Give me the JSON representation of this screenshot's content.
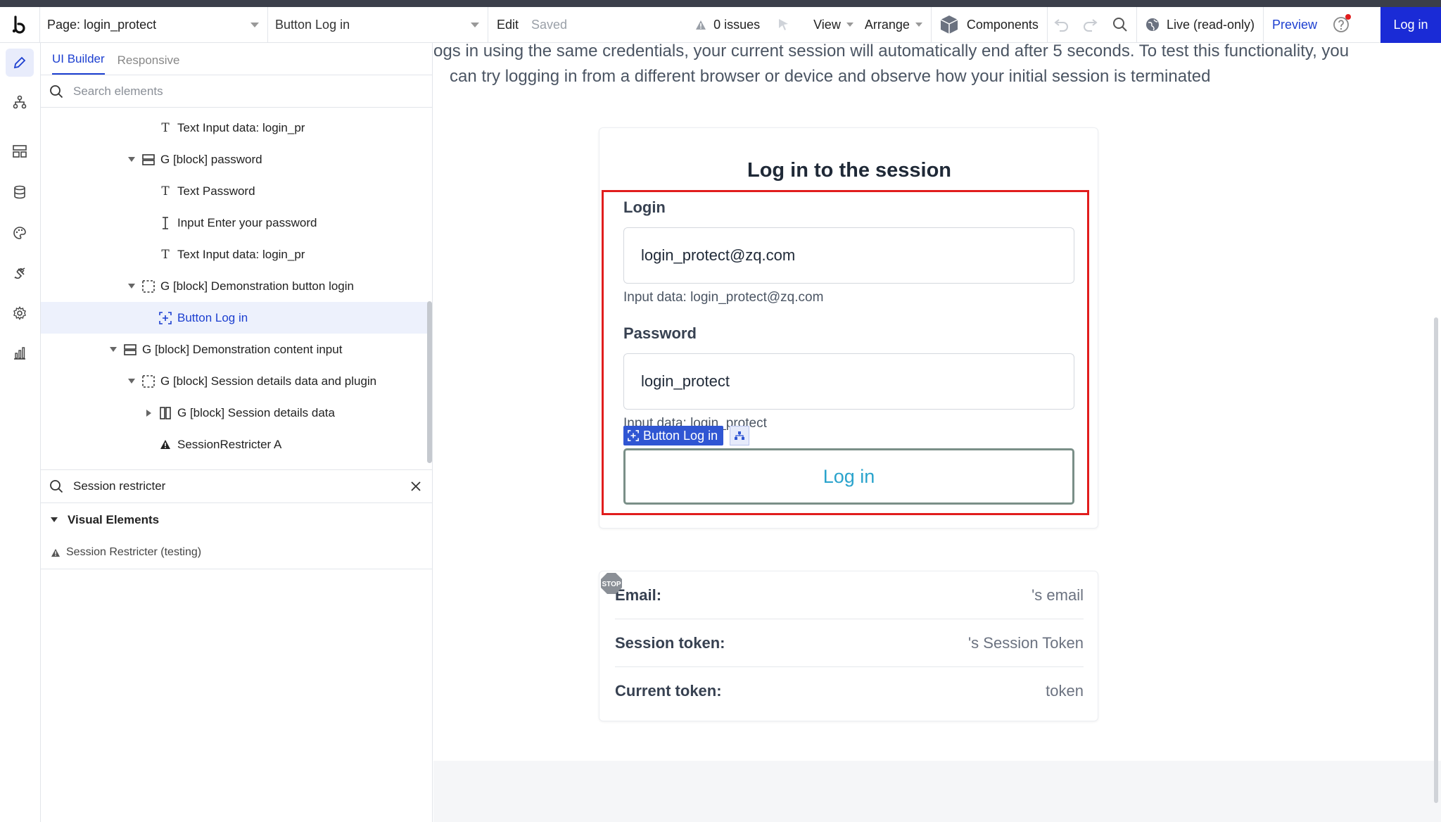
{
  "header": {
    "page_select": "Page: login_protect",
    "element_select": "Button Log in",
    "edit": "Edit",
    "saved": "Saved",
    "issues": "0 issues",
    "view": "View",
    "arrange": "Arrange",
    "components": "Components",
    "live": "Live (read-only)",
    "preview": "Preview",
    "login": "Log in"
  },
  "panel": {
    "tabs": [
      "UI Builder",
      "Responsive"
    ],
    "search_placeholder": "Search elements",
    "tree": [
      {
        "label": "Text Input data: login_pr",
        "icon": "text-icon"
      },
      {
        "label": "G [block] password",
        "icon": "group-icon",
        "expanded": true
      },
      {
        "label": "Text Password",
        "icon": "text-icon"
      },
      {
        "label": "Input Enter your password",
        "icon": "input-icon"
      },
      {
        "label": "Text Input data: login_pr",
        "icon": "text-icon"
      },
      {
        "label": "G [block] Demonstration button login",
        "icon": "dashed-group-icon",
        "expanded": true
      },
      {
        "label": "Button Log in",
        "icon": "button-icon",
        "selected": true
      },
      {
        "label": "G [block] Demonstration content input",
        "icon": "group-icon",
        "expanded": true
      },
      {
        "label": "G [block] Session details data and plugin",
        "icon": "dashed-group-icon",
        "expanded": true
      },
      {
        "label": "G [block] Session details data",
        "icon": "columns-icon",
        "expanded": false
      },
      {
        "label": "SessionRestricter A",
        "icon": "warning-icon"
      }
    ],
    "plugin_search": "Session restricter",
    "section_label": "Visual Elements",
    "plugin_item": "Session Restricter (testing)"
  },
  "canvas": {
    "intro_line1": "ogs in using the same credentials, your current session will automatically end after 5 seconds. To test this functionality, you",
    "intro_line2": "can try logging in from a different browser or device and observe how your initial session is terminated",
    "card_title": "Log in to the session",
    "login_label": "Login",
    "login_value": "login_protect@zq.com",
    "login_note": "Input data: login_protect@zq.com",
    "password_label": "Password",
    "password_value": "login_protect",
    "password_note": "Input data: login_protect",
    "badge_label": "Button Log in",
    "button_label": "Log in",
    "stop_label": "STOP",
    "session_rows": [
      {
        "key": "Email:",
        "value": "'s email"
      },
      {
        "key": "Session token:",
        "value": "'s Session Token"
      },
      {
        "key": "Current token:",
        "value": "token"
      }
    ]
  },
  "colors": {
    "accent": "#1c3fd0",
    "primary_button": "#1a2bd6",
    "highlight_border": "#e11d1d",
    "login_button_text": "#2aa3cc"
  }
}
